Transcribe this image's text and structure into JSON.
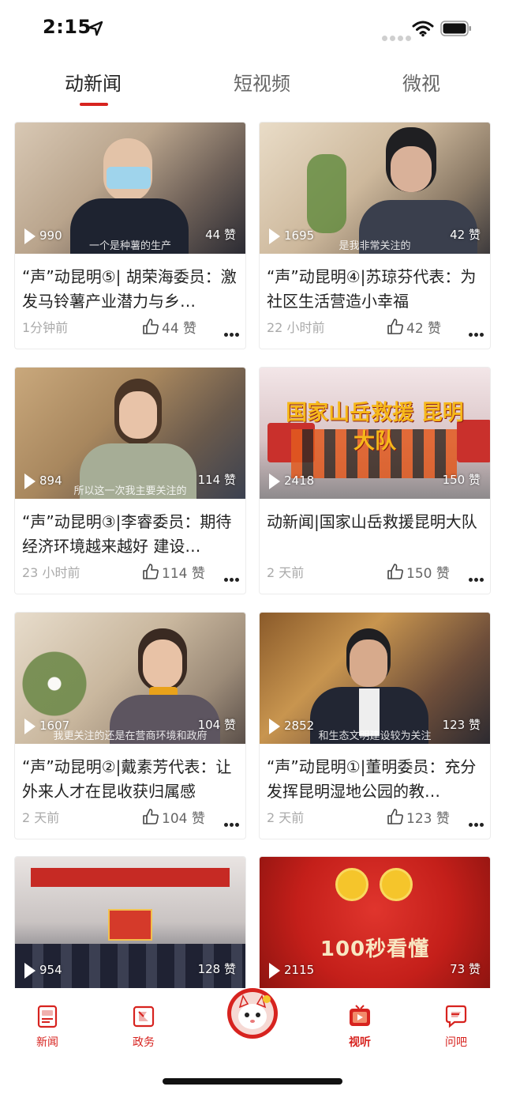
{
  "status_bar": {
    "time": "2:15"
  },
  "tabs": [
    {
      "label": "动新闻",
      "active": true
    },
    {
      "label": "短视频",
      "active": false
    },
    {
      "label": "微视",
      "active": false
    }
  ],
  "accent_color": "#d7231f",
  "cards": [
    {
      "title": "“声”动昆明⑤| 胡荣海委员：激发马铃薯产业潜力与乡…",
      "views": "990",
      "likes_overlay": "44 赞",
      "time": "1分钟前",
      "likes": "44 赞",
      "subtitle": "一个是种薯的生产"
    },
    {
      "title": "“声”动昆明④|苏琼芬代表：为社区生活营造小幸福",
      "views": "1695",
      "likes_overlay": "42 赞",
      "time": "22 小时前",
      "likes": "42 赞",
      "subtitle": "是我非常关注的"
    },
    {
      "title": "“声”动昆明③|李睿委员：期待经济环境越来越好 建设…",
      "views": "894",
      "likes_overlay": "114 赞",
      "time": "23 小时前",
      "likes": "114 赞",
      "subtitle": "所以这一次我主要关注的"
    },
    {
      "title": "动新闻|国家山岳救援昆明大队",
      "views": "2418",
      "likes_overlay": "150 赞",
      "time": "2 天前",
      "likes": "150 赞",
      "subtitle": "",
      "overlay_text": "国家山岳救援 昆明大队"
    },
    {
      "title": "“声”动昆明②|戴素芳代表：让外来人才在昆收获归属感",
      "views": "1607",
      "likes_overlay": "104 赞",
      "time": "2 天前",
      "likes": "104 赞",
      "subtitle": "我更关注的还是在营商环境和政府"
    },
    {
      "title": "“声”动昆明①|董明委员：充分发挥昆明湿地公园的教…",
      "views": "2852",
      "likes_overlay": "123 赞",
      "time": "2 天前",
      "likes": "123 赞",
      "subtitle": "和生态文明建设较为关注"
    },
    {
      "title": "",
      "views": "954",
      "likes_overlay": "128 赞",
      "time": "",
      "likes": "",
      "subtitle": ""
    },
    {
      "title": "",
      "views": "2115",
      "likes_overlay": "73 赞",
      "time": "",
      "likes": "",
      "subtitle": "",
      "overlay_text": "100秒看懂"
    }
  ],
  "tabbar": {
    "items": [
      {
        "label": "新闻",
        "icon": "news-icon"
      },
      {
        "label": "政务",
        "icon": "gov-icon"
      },
      {
        "label": "",
        "icon": "mascot-icon"
      },
      {
        "label": "视听",
        "icon": "media-icon",
        "active": true
      },
      {
        "label": "问吧",
        "icon": "ask-icon"
      }
    ]
  }
}
